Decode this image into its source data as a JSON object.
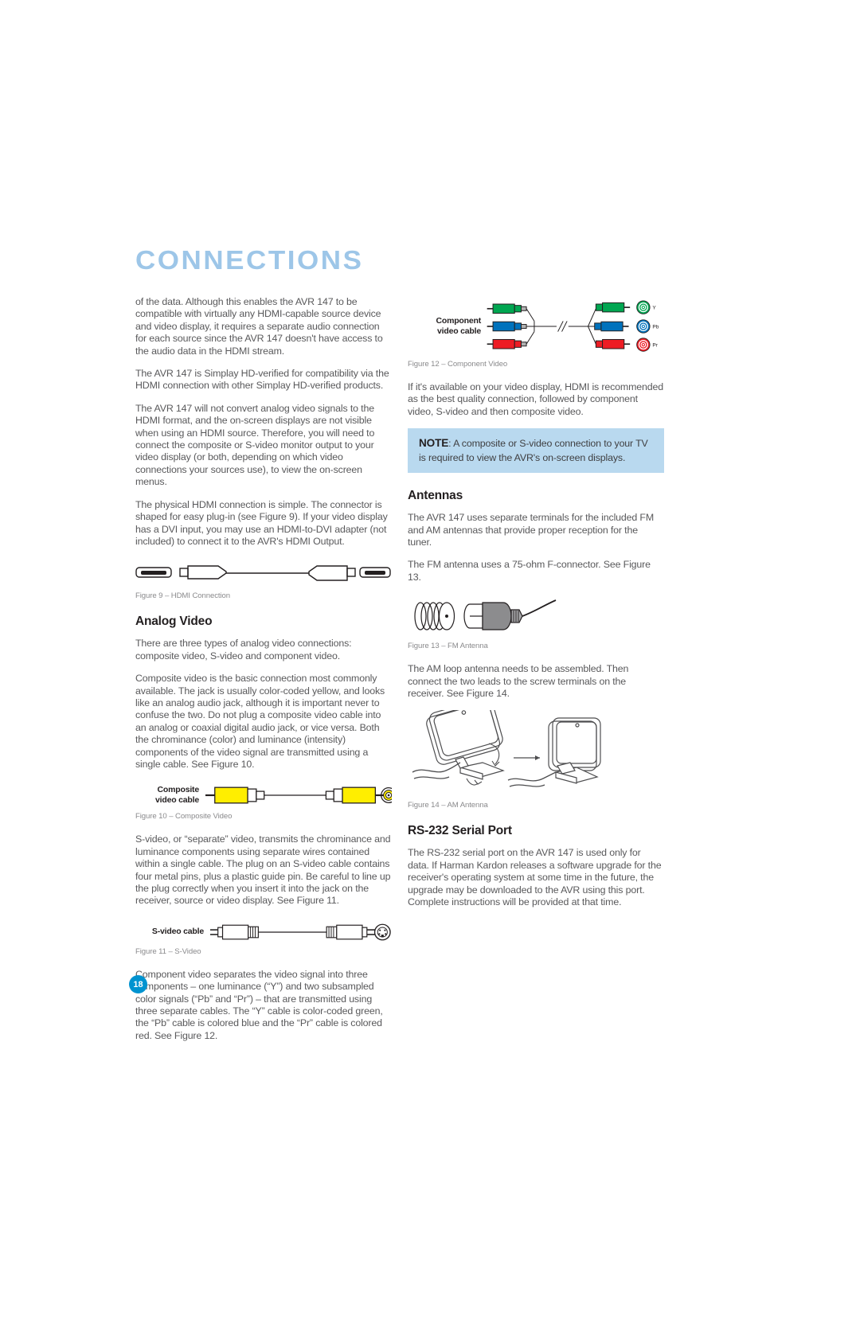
{
  "page": {
    "title": "CONNECTIONS",
    "number": "18",
    "title_color": "#9dc6e8",
    "page_number_color": "#0093d0",
    "note_bg_color": "#b9d9ef"
  },
  "left_column": {
    "paragraphs": [
      "of the data. Although this enables the AVR 147 to be compatible with virtually any HDMI-capable source device and video display, it requires a separate audio connection for each source since the AVR 147 doesn't have access to the audio data in the HDMI stream.",
      "The AVR 147 is Simplay HD-verified for compatibility via the HDMI connection with other Simplay HD-verified products.",
      "The AVR 147 will not convert analog video signals to the HDMI format, and the on-screen displays are not visible when using an HDMI source. Therefore, you will need to connect the composite or S-video monitor output to your video display (or both, depending on which video connections your sources use), to view the on-screen menus.",
      "The physical HDMI connection is simple. The connector is shaped for easy plug-in (see Figure 9). If your video display has a DVI input, you may use an HDMI-to-DVI adapter (not included) to connect it to the AVR's HDMI Output."
    ],
    "figure9_caption": "Figure 9 – HDMI Connection",
    "analog_video_heading": "Analog Video",
    "analog_paragraphs": [
      "There are three types of analog video connections: composite video, S-video and component video.",
      "Composite video is the basic connection most commonly available. The jack is usually color-coded yellow, and looks like an analog audio jack, although it is important never to confuse the two. Do not plug a composite video cable into an analog or coaxial digital audio jack, or vice versa. Both the chrominance (color) and luminance (intensity) components of the video signal are transmitted using a single cable. See Figure 10."
    ],
    "composite_cable_label_line1": "Composite",
    "composite_cable_label_line2": "video cable",
    "figure10_caption": "Figure 10 – Composite Video",
    "svideo_paragraph": "S-video, or “separate” video, transmits the chrominance and luminance components using separate wires contained within a single cable. The plug on an S-video cable contains four metal pins, plus a plastic guide pin. Be careful to line up the plug correctly when you insert it into the jack on the receiver, source or video display. See Figure 11.",
    "svideo_cable_label": "S-video cable",
    "figure11_caption": "Figure 11 – S-Video",
    "component_paragraph": "Component video separates the video signal into three components – one luminance (“Y”) and two subsampled color signals (“Pb” and “Pr”) – that are transmitted using three separate cables. The “Y” cable is color-coded green, the “Pb” cable is colored blue and the “Pr” cable is colored red. See Figure 12."
  },
  "right_column": {
    "component_cable_label_line1": "Component",
    "component_cable_label_line2": "video cable",
    "component_jack_labels": [
      "Y",
      "Pb",
      "Pr"
    ],
    "component_colors": [
      "#00a651",
      "#0072bc",
      "#ed1c24"
    ],
    "figure12_caption": "Figure 12 – Component Video",
    "hdmi_paragraph": "If it's available on your video display, HDMI is recommended as the best quality connection, followed by component video, S-video and then composite video.",
    "note": {
      "label": "NOTE",
      "text": ": A composite or S-video connection to your TV is required to view the AVR's on-screen displays."
    },
    "antennas_heading": "Antennas",
    "antennas_paragraphs": [
      "The AVR 147 uses separate terminals for the included FM and AM antennas that provide proper reception for the tuner.",
      "The FM antenna uses a 75-ohm F-connector. See Figure 13."
    ],
    "figure13_caption": "Figure 13 – FM Antenna",
    "am_paragraph": "The AM loop antenna needs to be assembled. Then connect the two leads to the screw terminals on the receiver. See Figure 14.",
    "figure14_caption": "Figure 14 – AM Antenna",
    "rs232_heading": "RS-232 Serial Port",
    "rs232_paragraph": "The RS-232 serial port on the AVR 147 is used only for data. If Harman Kardon releases a software upgrade for the receiver's operating system at some time in the future, the upgrade may be downloaded to the AVR using this port. Complete instructions will be provided at that time."
  }
}
